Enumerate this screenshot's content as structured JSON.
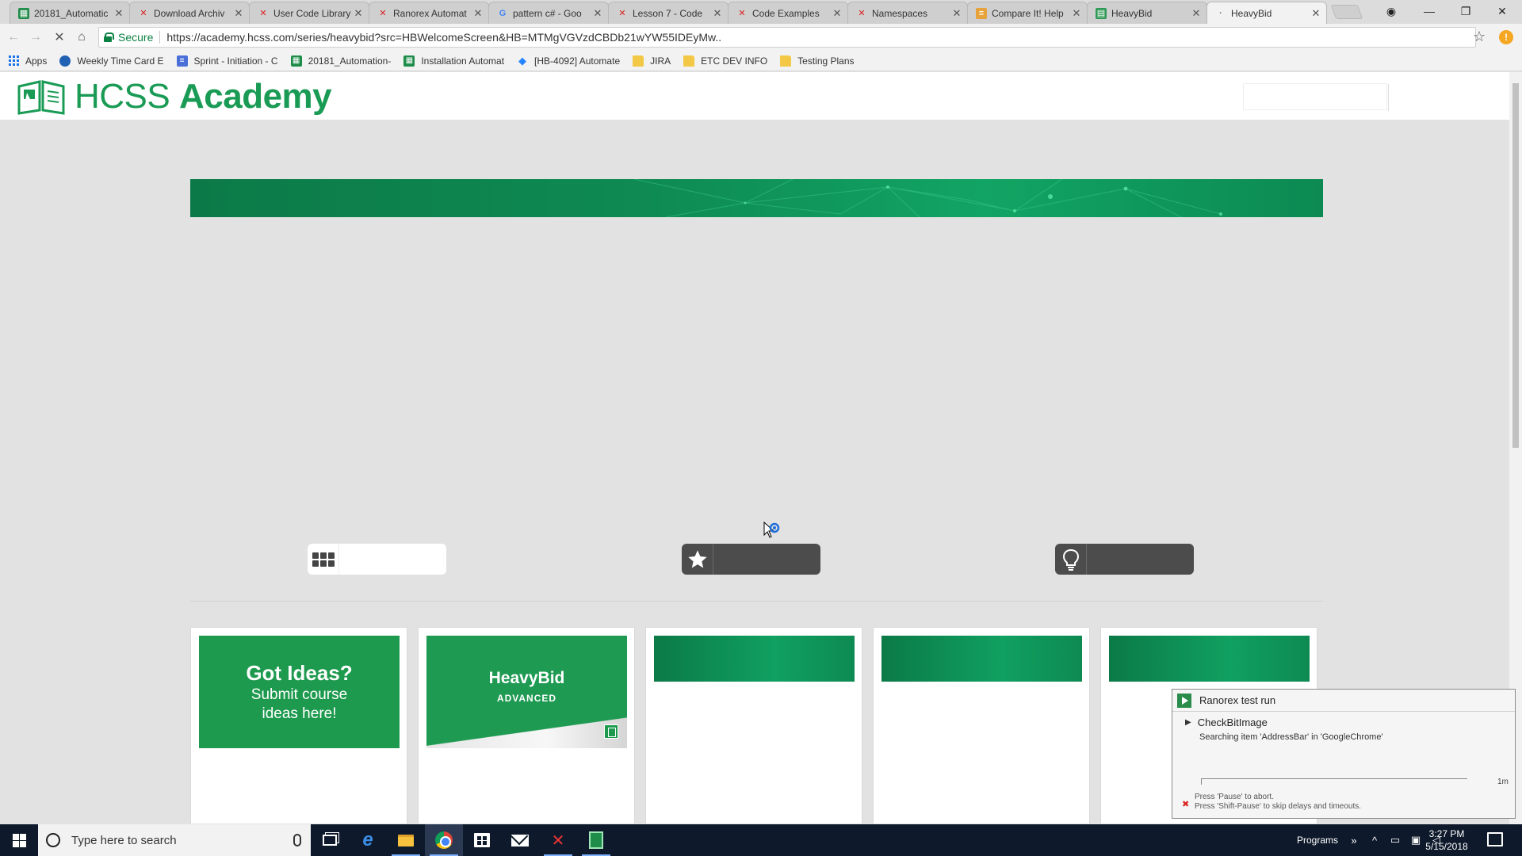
{
  "browser": {
    "tabs": [
      {
        "title": "20181_Automatic",
        "icon": "spreadsheet-icon"
      },
      {
        "title": "Download Archiv",
        "icon": "ranorex-icon"
      },
      {
        "title": "User Code Library",
        "icon": "ranorex-icon"
      },
      {
        "title": "Ranorex Automat",
        "icon": "ranorex-icon"
      },
      {
        "title": "pattern c# - Goo",
        "icon": "google-icon"
      },
      {
        "title": "Lesson 7 - Code",
        "icon": "ranorex-icon"
      },
      {
        "title": "Code Examples",
        "icon": "ranorex-icon"
      },
      {
        "title": "Namespaces",
        "icon": "ranorex-icon"
      },
      {
        "title": "Compare It! Help",
        "icon": "compare-icon"
      },
      {
        "title": "HeavyBid",
        "icon": "book-icon"
      },
      {
        "title": "HeavyBid",
        "icon": "loading-dot-icon",
        "active": true
      }
    ],
    "secure_label": "Secure",
    "url": "https://academy.hcss.com/series/heavybid?src=HBWelcomeScreen&HB=MTMgVGVzdCBDb21wYW55IDEyMw..",
    "extension_badge": "!",
    "bookmarks": [
      {
        "label": "Apps",
        "icon": "apps-grid-icon"
      },
      {
        "label": "Weekly Time Card E",
        "icon": "cloud-icon"
      },
      {
        "label": "Sprint - Initiation - C",
        "icon": "doc-icon"
      },
      {
        "label": "20181_Automation-",
        "icon": "spreadsheet-icon"
      },
      {
        "label": "Installation Automat",
        "icon": "spreadsheet-icon"
      },
      {
        "label": "[HB-4092] Automate",
        "icon": "jira-icon"
      },
      {
        "label": "JIRA",
        "icon": "folder-icon"
      },
      {
        "label": "ETC DEV INFO",
        "icon": "folder-icon"
      },
      {
        "label": "Testing Plans",
        "icon": "folder-icon"
      }
    ]
  },
  "site": {
    "logo_light": "HCSS ",
    "logo_bold": "Academy",
    "cards": [
      {
        "kind": "ideas",
        "line1": "Got Ideas?",
        "line2": "Submit course",
        "line3": "ideas here!"
      },
      {
        "kind": "heavybid",
        "title": "HeavyBid",
        "subtitle": "ADVANCED"
      },
      {
        "kind": "placeholder"
      },
      {
        "kind": "placeholder"
      },
      {
        "kind": "placeholder"
      }
    ]
  },
  "ranorex": {
    "title": "Ranorex test run",
    "step": "CheckBitImage",
    "message": "Searching item 'AddressBar' in 'GoogleChrome'",
    "time": "1m",
    "hint1": "Press 'Pause' to abort.",
    "hint2": "Press 'Shift-Pause' to skip delays and timeouts."
  },
  "taskbar": {
    "search_placeholder": "Type here to search",
    "programs_label": "Programs",
    "time": "3:27 PM",
    "date": "5/15/2018"
  },
  "colors": {
    "brand_green": "#1a9b55",
    "ranorex_green": "#2a8c4a",
    "taskbar_bg": "#0e1a2b"
  }
}
